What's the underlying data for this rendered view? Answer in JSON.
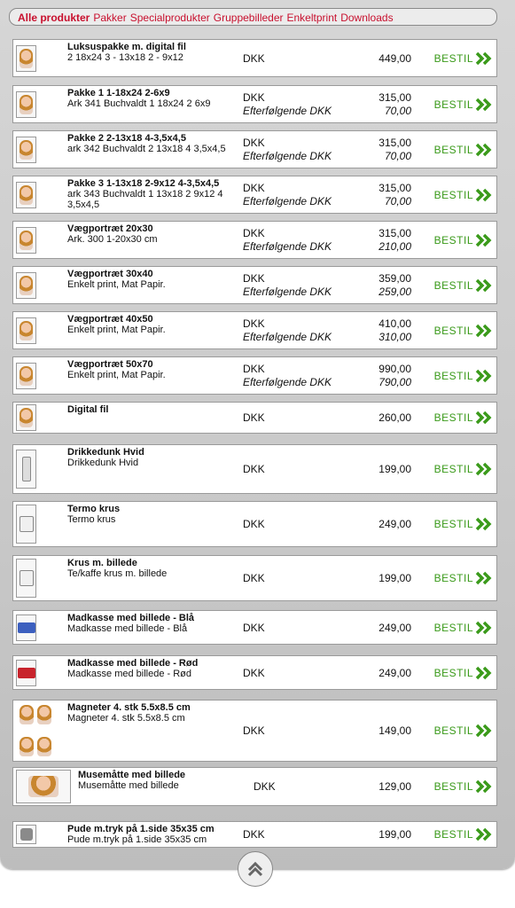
{
  "nav": [
    {
      "label": "Alle produkter",
      "active": true
    },
    {
      "label": "Pakker",
      "active": false
    },
    {
      "label": "Specialprodukter",
      "active": false
    },
    {
      "label": "Gruppebilleder",
      "active": false
    },
    {
      "label": "Enkeltprint",
      "active": false
    },
    {
      "label": "Downloads",
      "active": false
    }
  ],
  "products": [
    {
      "title": "Luksuspakke m. digital fil",
      "desc": "2 18x24 3 - 13x18 2 - 9x12",
      "currency": "DKK",
      "price": "449,00",
      "follow_label": "",
      "follow_price": "",
      "order_label": "BESTIL",
      "icon": "portrait-icon"
    },
    {
      "title": "Pakke 1 1-18x24 2-6x9",
      "desc": "Ark 341 Buchvaldt 1 18x24 2 6x9",
      "currency": "DKK",
      "price": "315,00",
      "follow_label": "Efterfølgende DKK",
      "follow_price": "70,00",
      "order_label": "BESTIL",
      "icon": "portrait-icon"
    },
    {
      "title": "Pakke 2 2-13x18 4-3,5x4,5",
      "desc": "ark 342 Buchvaldt 2 13x18 4 3,5x4,5",
      "currency": "DKK",
      "price": "315,00",
      "follow_label": "Efterfølgende DKK",
      "follow_price": "70,00",
      "order_label": "BESTIL",
      "icon": "portrait-icon"
    },
    {
      "title": "Pakke 3 1-13x18 2-9x12 4-3,5x4,5",
      "desc": "ark 343 Buchvaldt 1 13x18 2 9x12 4 3,5x4,5",
      "currency": "DKK",
      "price": "315,00",
      "follow_label": "Efterfølgende DKK",
      "follow_price": "70,00",
      "order_label": "BESTIL",
      "icon": "portrait-icon"
    },
    {
      "title": "Vægportræt 20x30",
      "desc": "Ark. 300 1-20x30 cm",
      "currency": "DKK",
      "price": "315,00",
      "follow_label": "Efterfølgende DKK",
      "follow_price": "210,00",
      "order_label": "BESTIL",
      "icon": "portrait-icon"
    },
    {
      "title": "Vægportræt 30x40",
      "desc": "Enkelt print, Mat Papir.",
      "currency": "DKK",
      "price": "359,00",
      "follow_label": "Efterfølgende DKK",
      "follow_price": "259,00",
      "order_label": "BESTIL",
      "icon": "portrait-icon"
    },
    {
      "title": "Vægportræt 40x50",
      "desc": "Enkelt print, Mat Papir.",
      "currency": "DKK",
      "price": "410,00",
      "follow_label": "Efterfølgende DKK",
      "follow_price": "310,00",
      "order_label": "BESTIL",
      "icon": "portrait-icon"
    },
    {
      "title": "Vægportræt 50x70",
      "desc": "Enkelt print, Mat Papir.",
      "currency": "DKK",
      "price": "990,00",
      "follow_label": "Efterfølgende DKK",
      "follow_price": "790,00",
      "order_label": "BESTIL",
      "icon": "portrait-icon"
    },
    {
      "title": "Digital fil",
      "desc": "",
      "currency": "DKK",
      "price": "260,00",
      "follow_label": "",
      "follow_price": "",
      "order_label": "BESTIL",
      "icon": "portrait-icon"
    },
    {
      "title": "Drikkedunk Hvid",
      "desc": "Drikkedunk Hvid",
      "currency": "DKK",
      "price": "199,00",
      "follow_label": "",
      "follow_price": "",
      "order_label": "BESTIL",
      "icon": "bottle-icon"
    },
    {
      "title": "Termo krus",
      "desc": "Termo krus",
      "currency": "DKK",
      "price": "249,00",
      "follow_label": "",
      "follow_price": "",
      "order_label": "BESTIL",
      "icon": "thermo-mug-icon"
    },
    {
      "title": "Krus m. billede",
      "desc": "Te/kaffe krus m. billede",
      "currency": "DKK",
      "price": "199,00",
      "follow_label": "",
      "follow_price": "",
      "order_label": "BESTIL",
      "icon": "mug-icon"
    },
    {
      "title": "Madkasse med billede - Blå",
      "desc": "Madkasse med billede - Blå",
      "currency": "DKK",
      "price": "249,00",
      "follow_label": "",
      "follow_price": "",
      "order_label": "BESTIL",
      "icon": "lunchbox-blue-icon"
    },
    {
      "title": "Madkasse med billede - Rød",
      "desc": "Madkasse med billede - Rød",
      "currency": "DKK",
      "price": "249,00",
      "follow_label": "",
      "follow_price": "",
      "order_label": "BESTIL",
      "icon": "lunchbox-red-icon"
    },
    {
      "title": "Magneter 4. stk 5.5x8.5 cm",
      "desc": "Magneter 4. stk 5.5x8.5 cm",
      "currency": "DKK",
      "price": "149,00",
      "follow_label": "",
      "follow_price": "",
      "order_label": "BESTIL",
      "icon": "magnets-icon"
    },
    {
      "title": "Musemåtte med billede",
      "desc": "Musemåtte med billede",
      "currency": "DKK",
      "price": "129,00",
      "follow_label": "",
      "follow_price": "",
      "order_label": "BESTIL",
      "icon": "mousepad-icon"
    },
    {
      "title": "Pude m.tryk på 1.side 35x35 cm",
      "desc": "Pude m.tryk på 1.side 35x35 cm",
      "currency": "DKK",
      "price": "199,00",
      "follow_label": "",
      "follow_price": "",
      "order_label": "BESTIL",
      "icon": "pillow-icon"
    }
  ],
  "colors": {
    "accent": "#c8102e",
    "order_green": "#3a9a1a",
    "panel": "#cfcfcf"
  },
  "scroll_top_icon": "double-chevron-up-icon"
}
